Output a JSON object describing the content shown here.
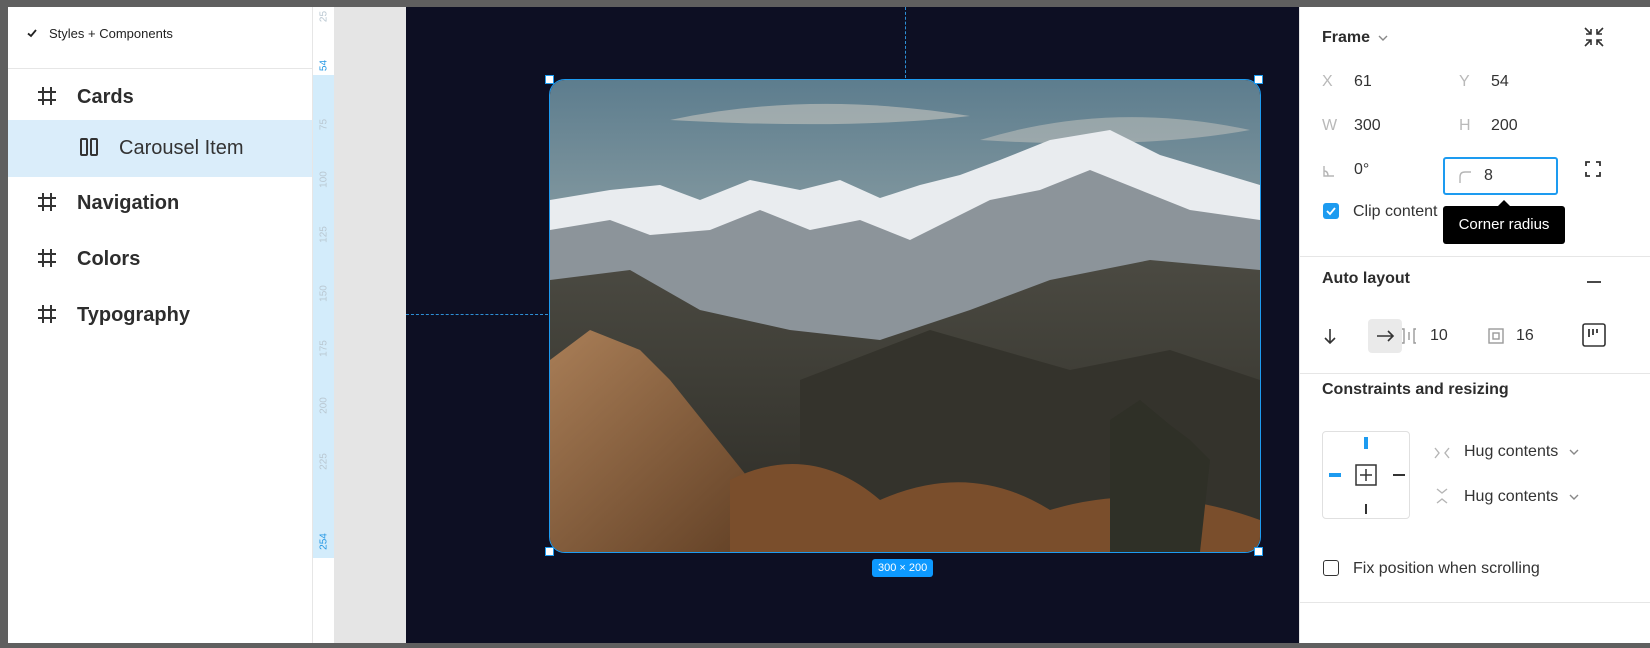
{
  "left_panel": {
    "header": "Styles + Components",
    "layers": [
      {
        "label": "Cards",
        "icon": "frame-hash-icon"
      },
      {
        "label": "Carousel Item",
        "icon": "carousel-icon"
      },
      {
        "label": "Navigation",
        "icon": "frame-hash-icon"
      },
      {
        "label": "Colors",
        "icon": "frame-hash-icon"
      },
      {
        "label": "Typography",
        "icon": "frame-hash-icon"
      }
    ]
  },
  "ruler": {
    "ticks": [
      "25",
      "54",
      "75",
      "100",
      "125",
      "150",
      "175",
      "200",
      "225",
      "254"
    ]
  },
  "canvas": {
    "size_badge": "300 × 200"
  },
  "right_panel": {
    "frame": {
      "title": "Frame",
      "x_label": "X",
      "x_value": "61",
      "y_label": "Y",
      "y_value": "54",
      "w_label": "W",
      "w_value": "300",
      "h_label": "H",
      "h_value": "200",
      "rotation": "0°",
      "radius": "8",
      "tooltip": "Corner radius",
      "clip_content": "Clip content"
    },
    "auto_layout": {
      "title": "Auto layout",
      "gap": "10",
      "padding": "16"
    },
    "constraints": {
      "title": "Constraints and resizing",
      "horizontal": "Hug contents",
      "vertical": "Hug contents",
      "fix_position": "Fix position when scrolling"
    }
  },
  "colors": {
    "accent": "#1d9bf0",
    "canvas": "#0d0f23",
    "selection": "#daedfa"
  }
}
